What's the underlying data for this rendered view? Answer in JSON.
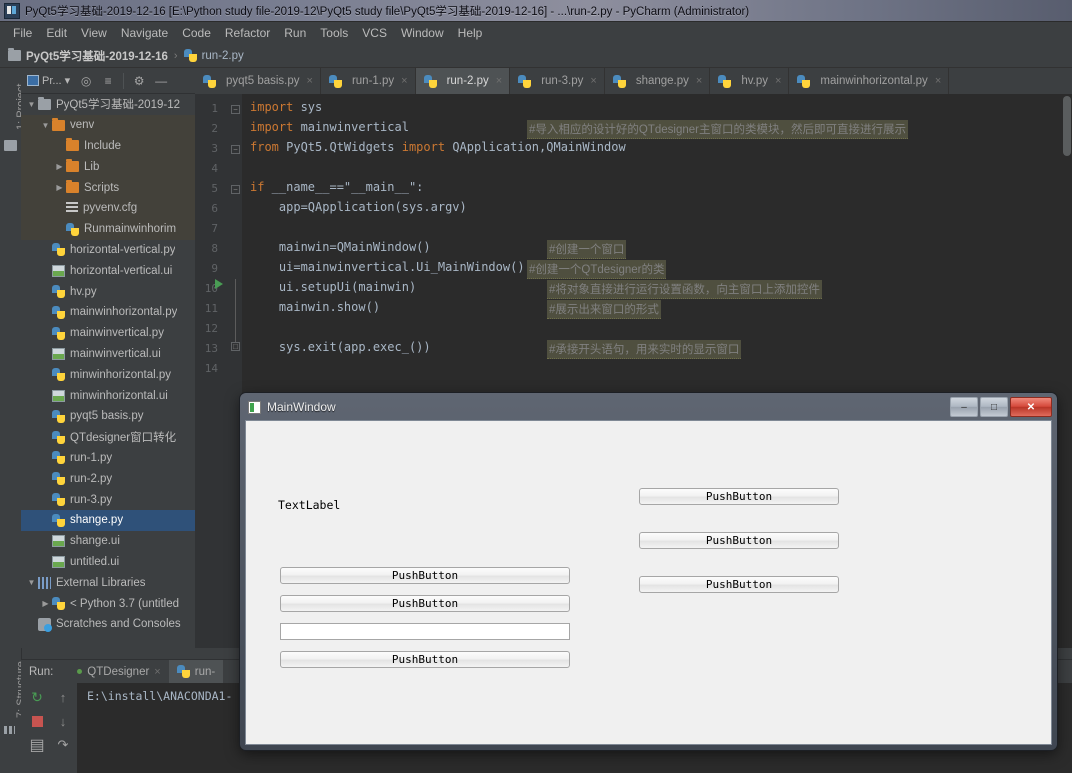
{
  "titlebar": {
    "icon": "pycharm-icon",
    "text": "PyQt5学习基础-2019-12-16 [E:\\Python study file-2019-12\\PyQt5 study file\\PyQt5学习基础-2019-12-16] - ...\\run-2.py - PyCharm (Administrator)"
  },
  "menubar": {
    "items": [
      "File",
      "Edit",
      "View",
      "Navigate",
      "Code",
      "Refactor",
      "Run",
      "Tools",
      "VCS",
      "Window",
      "Help"
    ]
  },
  "breadcrumb": {
    "project": "PyQt5学习基础-2019-12-16",
    "separator": "›",
    "file": "run-2.py"
  },
  "left_strips": {
    "project": "1: Project",
    "structure": "7: Structure"
  },
  "project_toolbar": {
    "selector_label": "Pr...",
    "chevron": "▾",
    "icons": [
      "locate-icon",
      "collapse-all-icon",
      "settings-icon",
      "hide-icon"
    ]
  },
  "project_tree": {
    "items": [
      {
        "label": "PyQt5学习基础-2019-12",
        "icon": "folder-icon",
        "arrow": "▼",
        "indent": 0,
        "state": "normal"
      },
      {
        "label": "venv",
        "icon": "folder-orange-icon",
        "arrow": "▼",
        "indent": 1,
        "state": "dim"
      },
      {
        "label": "Include",
        "icon": "folder-orange-icon",
        "arrow": "",
        "indent": 2,
        "state": "dim"
      },
      {
        "label": "Lib",
        "icon": "folder-orange-icon",
        "arrow": "▶",
        "indent": 2,
        "state": "dim"
      },
      {
        "label": "Scripts",
        "icon": "folder-orange-icon",
        "arrow": "▶",
        "indent": 2,
        "state": "dim"
      },
      {
        "label": "pyvenv.cfg",
        "icon": "cfg-icon",
        "arrow": "",
        "indent": 2,
        "state": "dim"
      },
      {
        "label": "Runmainwinhorim",
        "icon": "py-icon",
        "arrow": "",
        "indent": 2,
        "state": "dim"
      },
      {
        "label": "horizontal-vertical.py",
        "icon": "py-icon",
        "arrow": "",
        "indent": 1,
        "state": "normal"
      },
      {
        "label": "horizontal-vertical.ui",
        "icon": "ui-icon",
        "arrow": "",
        "indent": 1,
        "state": "normal"
      },
      {
        "label": "hv.py",
        "icon": "py-icon",
        "arrow": "",
        "indent": 1,
        "state": "normal"
      },
      {
        "label": "mainwinhorizontal.py",
        "icon": "py-icon",
        "arrow": "",
        "indent": 1,
        "state": "normal"
      },
      {
        "label": "mainwinvertical.py",
        "icon": "py-icon",
        "arrow": "",
        "indent": 1,
        "state": "normal"
      },
      {
        "label": "mainwinvertical.ui",
        "icon": "ui-icon",
        "arrow": "",
        "indent": 1,
        "state": "normal"
      },
      {
        "label": "minwinhorizontal.py",
        "icon": "py-icon",
        "arrow": "",
        "indent": 1,
        "state": "normal"
      },
      {
        "label": "minwinhorizontal.ui",
        "icon": "ui-icon",
        "arrow": "",
        "indent": 1,
        "state": "normal"
      },
      {
        "label": "pyqt5 basis.py",
        "icon": "py-icon",
        "arrow": "",
        "indent": 1,
        "state": "normal"
      },
      {
        "label": "QTdesigner窗口转化",
        "icon": "py-icon",
        "arrow": "",
        "indent": 1,
        "state": "normal"
      },
      {
        "label": "run-1.py",
        "icon": "py-icon",
        "arrow": "",
        "indent": 1,
        "state": "normal"
      },
      {
        "label": "run-2.py",
        "icon": "py-icon",
        "arrow": "",
        "indent": 1,
        "state": "normal"
      },
      {
        "label": "run-3.py",
        "icon": "py-icon",
        "arrow": "",
        "indent": 1,
        "state": "normal"
      },
      {
        "label": "shange.py",
        "icon": "py-icon",
        "arrow": "",
        "indent": 1,
        "state": "selected"
      },
      {
        "label": "shange.ui",
        "icon": "ui-icon",
        "arrow": "",
        "indent": 1,
        "state": "normal"
      },
      {
        "label": "untitled.ui",
        "icon": "ui-icon",
        "arrow": "",
        "indent": 1,
        "state": "normal"
      },
      {
        "label": "External Libraries",
        "icon": "library-icon",
        "arrow": "▼",
        "indent": 0,
        "state": "normal"
      },
      {
        "label": "< Python 3.7 (untitled",
        "icon": "py-icon",
        "arrow": "▶",
        "indent": 1,
        "state": "normal"
      },
      {
        "label": "Scratches and Consoles",
        "icon": "scratches-icon",
        "arrow": "",
        "indent": 0,
        "state": "normal"
      }
    ]
  },
  "editor_tabs": {
    "close_glyph": "×",
    "items": [
      {
        "label": "pyqt5 basis.py",
        "active": false
      },
      {
        "label": "run-1.py",
        "active": false
      },
      {
        "label": "run-2.py",
        "active": true
      },
      {
        "label": "run-3.py",
        "active": false
      },
      {
        "label": "shange.py",
        "active": false
      },
      {
        "label": "hv.py",
        "active": false
      },
      {
        "label": "mainwinhorizontal.py",
        "active": false
      }
    ]
  },
  "editor": {
    "line_numbers": [
      "1",
      "2",
      "3",
      "4",
      "5",
      "6",
      "7",
      "8",
      "9",
      "10",
      "11",
      "12",
      "13",
      "14"
    ],
    "lines": [
      {
        "n": 1,
        "code": "import sys",
        "comment": ""
      },
      {
        "n": 2,
        "code": "import mainwinvertical",
        "comment": "#导入相应的设计好的QTdesigner主窗口的类模块，然后即可直接进行展示"
      },
      {
        "n": 3,
        "code": "from PyQt5.QtWidgets import QApplication,QMainWindow",
        "comment": ""
      },
      {
        "n": 4,
        "code": "",
        "comment": ""
      },
      {
        "n": 5,
        "code": "if __name__==\"__main__\":",
        "comment": ""
      },
      {
        "n": 6,
        "code": "    app=QApplication(sys.argv)",
        "comment": ""
      },
      {
        "n": 7,
        "code": "",
        "comment": ""
      },
      {
        "n": 8,
        "code": "    mainwin=QMainWindow()",
        "comment": "#创建一个窗口"
      },
      {
        "n": 9,
        "code": "    ui=mainwinvertical.Ui_MainWindow()",
        "comment": "#创建一个QTdesigner的类"
      },
      {
        "n": 10,
        "code": "    ui.setupUi(mainwin)",
        "comment": "#将对象直接进行运行设置函数，向主窗口上添加控件"
      },
      {
        "n": 11,
        "code": "    mainwin.show()",
        "comment": "#展示出来窗口的形式"
      },
      {
        "n": 12,
        "code": "",
        "comment": ""
      },
      {
        "n": 13,
        "code": "    sys.exit(app.exec_())",
        "comment": "#承接开头语句，用来实时的显示窗口"
      },
      {
        "n": 14,
        "code": "",
        "comment": ""
      }
    ]
  },
  "run_panel": {
    "label": "Run:",
    "tabs": [
      {
        "label": "QTDesigner",
        "active": false
      },
      {
        "label": "run-",
        "active": true
      }
    ],
    "close_glyph": "×",
    "console_text": "E:\\install\\ANACONDA1-",
    "sidebar_icons": [
      "rerun-icon",
      "stop-icon",
      "print-icon",
      "scroll-up-icon",
      "scroll-down-icon",
      "soft-wrap-icon"
    ]
  },
  "qt_window": {
    "title": "MainWindow",
    "buttons": {
      "minimize": "–",
      "maximize": "□",
      "close": "✕"
    },
    "widgets": {
      "text_label": "TextLabel",
      "left_buttons": [
        "PushButton",
        "PushButton"
      ],
      "line_edit_value": "",
      "left_bottom_button": "PushButton",
      "right_buttons": [
        "PushButton",
        "PushButton",
        "PushButton"
      ]
    }
  },
  "colors": {
    "ide_bg": "#3c3f41",
    "editor_bg": "#2b2b2b",
    "gutter_bg": "#313335",
    "keyword": "#cc7832",
    "plain_text": "#a9b7c6",
    "comment": "#808080",
    "selection": "#2f5179",
    "accent_green": "#499c54",
    "close_red": "#d4483a"
  }
}
